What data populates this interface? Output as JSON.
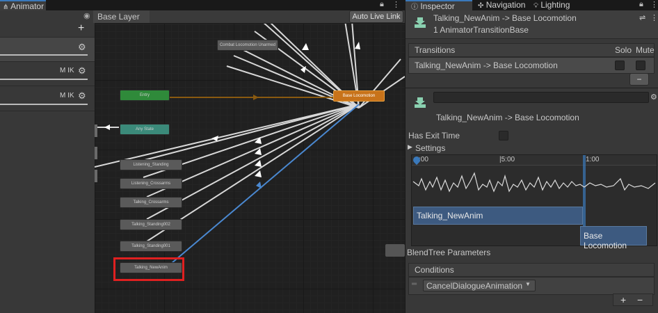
{
  "animator_tab": {
    "label": "Animator"
  },
  "left_panel": {
    "add_label": "+",
    "layers": [
      {
        "suffix": ""
      },
      {
        "suffix": "M IK"
      },
      {
        "suffix": "M IK"
      }
    ]
  },
  "graph": {
    "breadcrumb": "Base Layer",
    "auto_live_link": "Auto Live Link",
    "nodes": {
      "combat": "Combat Locomotion Unarmed",
      "entry": "Entry",
      "base_locomotion": "Base Locomotion",
      "any_state": "Any State",
      "listening_standing": "Listening_Standing",
      "listening_crossarms": "Listening_Crossarms",
      "talking_crossarms": "Talking_Crossarms",
      "talking_standing002": "Talking_Standing002",
      "talking_standing001": "Talking_Standing001",
      "talking_newanim": "Talking_NewAnim"
    }
  },
  "inspector": {
    "tabs": {
      "inspector": "Inspector",
      "navigation": "Navigation",
      "lighting": "Lighting"
    },
    "header": {
      "title": "Talking_NewAnim -> Base Locomotion",
      "subtitle": "1 AnimatorTransitionBase"
    },
    "transitions": {
      "header": "Transitions",
      "solo": "Solo",
      "mute": "Mute",
      "item": "Talking_NewAnim -> Base Locomotion",
      "remove": "−"
    },
    "transition_detail": {
      "name": "Talking_NewAnim -> Base Locomotion",
      "has_exit_time": "Has Exit Time",
      "settings": "Settings"
    },
    "timeline": {
      "ticks": [
        ":00",
        "|5:00",
        "1:00"
      ],
      "source_clip": "Talking_NewAnim",
      "dest_clip": "Base Locomotion"
    },
    "blend_tree": "BlendTree Parameters",
    "conditions": {
      "header": "Conditions",
      "value": "CancelDialogueAnimation",
      "add": "+",
      "remove": "−"
    }
  },
  "colors": {
    "accent": "#3a79bb",
    "base_locomotion": "#c8731a",
    "entry": "#2f8a3a",
    "any_state": "#3b8a7a",
    "highlight": "#e02020"
  }
}
